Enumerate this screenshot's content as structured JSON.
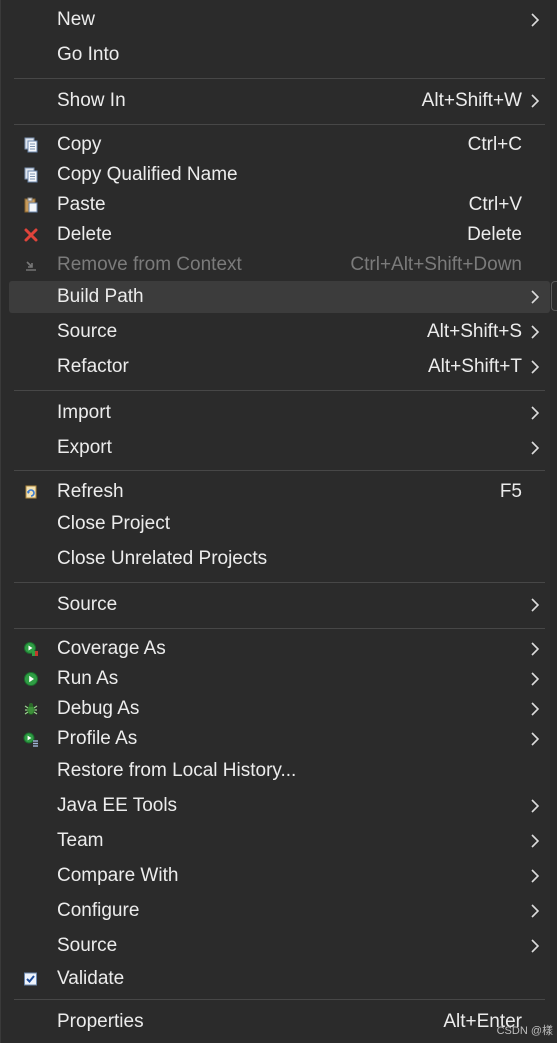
{
  "menu": {
    "items": [
      {
        "label": "New",
        "shortcut": "",
        "submenu": true
      },
      {
        "label": "Go Into",
        "shortcut": "",
        "submenu": false
      },
      {
        "label": "Show In",
        "shortcut": "Alt+Shift+W",
        "submenu": true
      },
      {
        "label": "Copy",
        "shortcut": "Ctrl+C",
        "submenu": false,
        "icon": "copy-icon"
      },
      {
        "label": "Copy Qualified Name",
        "shortcut": "",
        "submenu": false,
        "icon": "copy-qualified-name-icon"
      },
      {
        "label": "Paste",
        "shortcut": "Ctrl+V",
        "submenu": false,
        "icon": "paste-icon"
      },
      {
        "label": "Delete",
        "shortcut": "Delete",
        "submenu": false,
        "icon": "delete-icon"
      },
      {
        "label": "Remove from Context",
        "shortcut": "Ctrl+Alt+Shift+Down",
        "submenu": false,
        "icon": "remove-from-context-icon",
        "disabled": true
      },
      {
        "label": "Build Path",
        "shortcut": "",
        "submenu": true,
        "highlighted": true
      },
      {
        "label": "Source",
        "shortcut": "Alt+Shift+S",
        "submenu": true
      },
      {
        "label": "Refactor",
        "shortcut": "Alt+Shift+T",
        "submenu": true
      },
      {
        "label": "Import",
        "shortcut": "",
        "submenu": true
      },
      {
        "label": "Export",
        "shortcut": "",
        "submenu": true
      },
      {
        "label": "Refresh",
        "shortcut": "F5",
        "submenu": false,
        "icon": "refresh-icon"
      },
      {
        "label": "Close Project",
        "shortcut": "",
        "submenu": false
      },
      {
        "label": "Close Unrelated Projects",
        "shortcut": "",
        "submenu": false
      },
      {
        "label": "Source",
        "shortcut": "",
        "submenu": true
      },
      {
        "label": "Coverage As",
        "shortcut": "",
        "submenu": true,
        "icon": "coverage-icon"
      },
      {
        "label": "Run As",
        "shortcut": "",
        "submenu": true,
        "icon": "run-icon"
      },
      {
        "label": "Debug As",
        "shortcut": "",
        "submenu": true,
        "icon": "debug-bug-icon"
      },
      {
        "label": "Profile As",
        "shortcut": "",
        "submenu": true,
        "icon": "profile-icon"
      },
      {
        "label": "Restore from Local History...",
        "shortcut": "",
        "submenu": false
      },
      {
        "label": "Java EE Tools",
        "shortcut": "",
        "submenu": true
      },
      {
        "label": "Team",
        "shortcut": "",
        "submenu": true
      },
      {
        "label": "Compare With",
        "shortcut": "",
        "submenu": true
      },
      {
        "label": "Configure",
        "shortcut": "",
        "submenu": true
      },
      {
        "label": "Source",
        "shortcut": "",
        "submenu": true
      },
      {
        "label": "Validate",
        "shortcut": "",
        "submenu": false,
        "icon": "validate-checkbox-icon"
      },
      {
        "label": "Properties",
        "shortcut": "Alt+Enter",
        "submenu": false
      }
    ]
  },
  "watermark": "CSDN @樣",
  "colors": {
    "background": "#2b2b2b",
    "highlight": "#3c3c3c",
    "text": "#ececec",
    "disabled_text": "#7b7b7b",
    "separator": "#474747"
  }
}
